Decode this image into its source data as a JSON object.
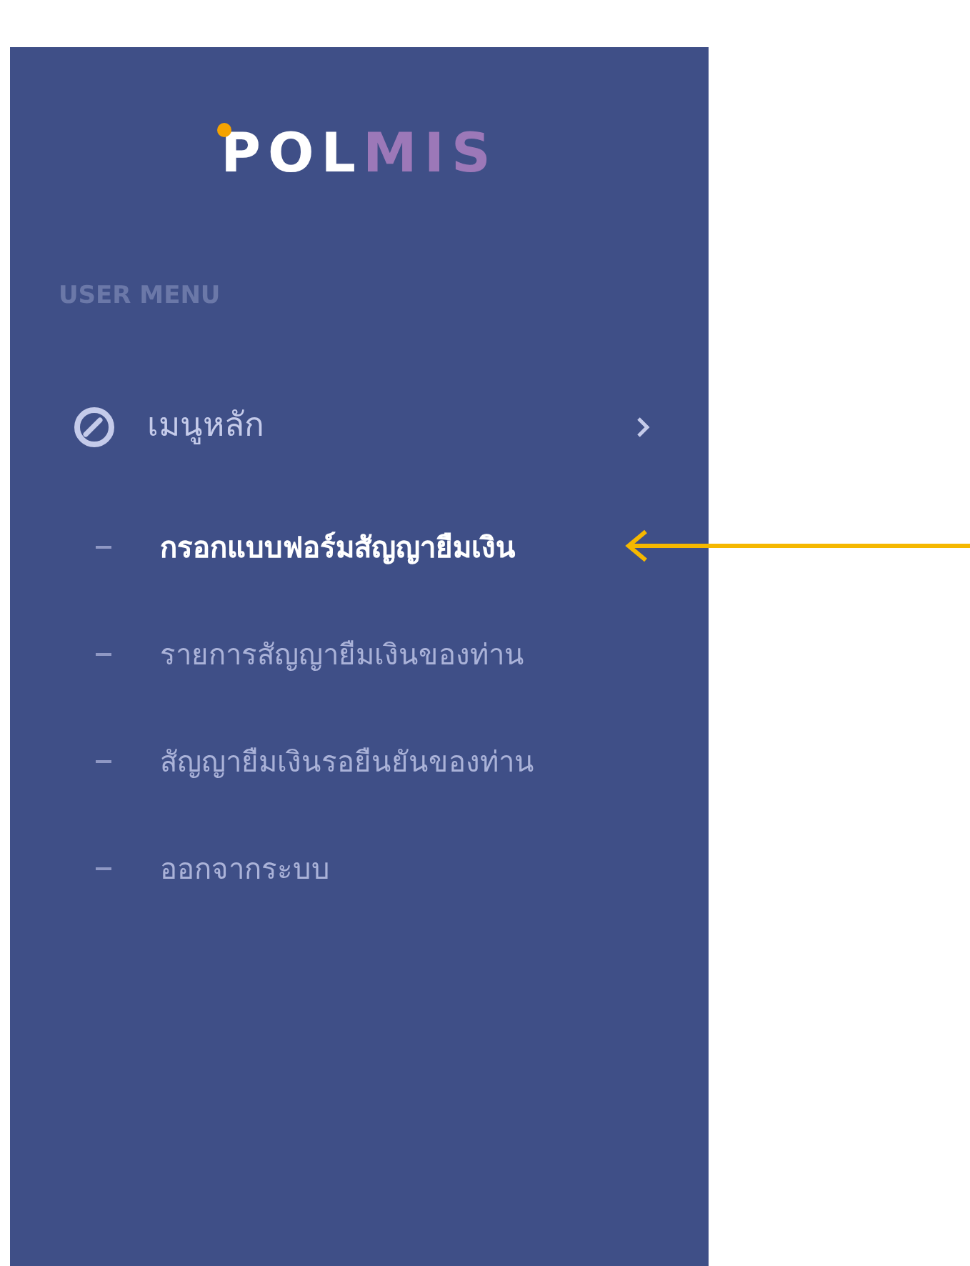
{
  "logo": {
    "parts": [
      {
        "text": "POL",
        "kind": "primary"
      },
      {
        "text": "MIS",
        "kind": "accent"
      }
    ]
  },
  "sidebar": {
    "section_title": "USER MENU",
    "menu": {
      "label": "เมนูหลัก",
      "expanded": true,
      "children": [
        {
          "label": "กรอกแบบฟอร์มสัญญายืมเงิน",
          "selected": true
        },
        {
          "label": "รายการสัญญายืมเงินของท่าน",
          "selected": false
        },
        {
          "label": "สัญญายืมเงินรอยืนยันของท่าน",
          "selected": false
        },
        {
          "label": "ออกจากระบบ",
          "selected": false
        }
      ]
    }
  },
  "annotation": {
    "kind": "arrow",
    "color": "#f5b800"
  }
}
